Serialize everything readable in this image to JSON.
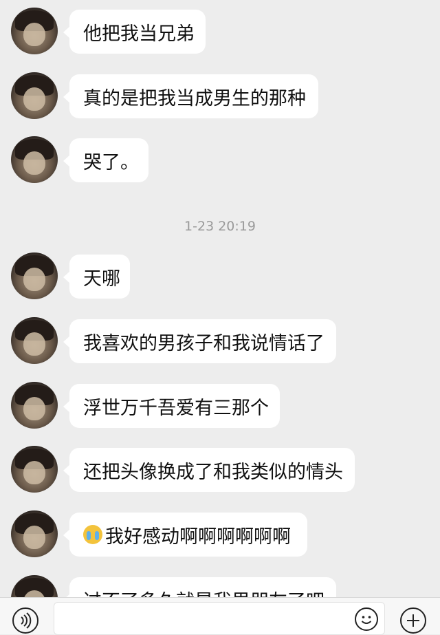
{
  "messages": [
    {
      "text": "他把我当兄弟"
    },
    {
      "text": "真的是把我当成男生的那种"
    },
    {
      "text": "哭了。"
    },
    {
      "text": "天哪"
    },
    {
      "text": "我喜欢的男孩子和我说情话了"
    },
    {
      "text": "浮世万千吾爱有三那个"
    },
    {
      "text": "还把头像换成了和我类似的情头"
    },
    {
      "text": "我好感动啊啊啊啊啊啊",
      "emoji": "crying-face-icon"
    },
    {
      "text": "过不了多久就是我男朋友了吧"
    }
  ],
  "timestamp": "1-23 20:19",
  "input": {
    "value": "",
    "placeholder": ""
  },
  "icons": {
    "voice": "voice-icon",
    "emoji": "emoji-icon",
    "more": "plus-icon"
  },
  "colors": {
    "background": "#ededed",
    "bubble": "#ffffff",
    "timestamp_text": "#9a9a9a"
  }
}
